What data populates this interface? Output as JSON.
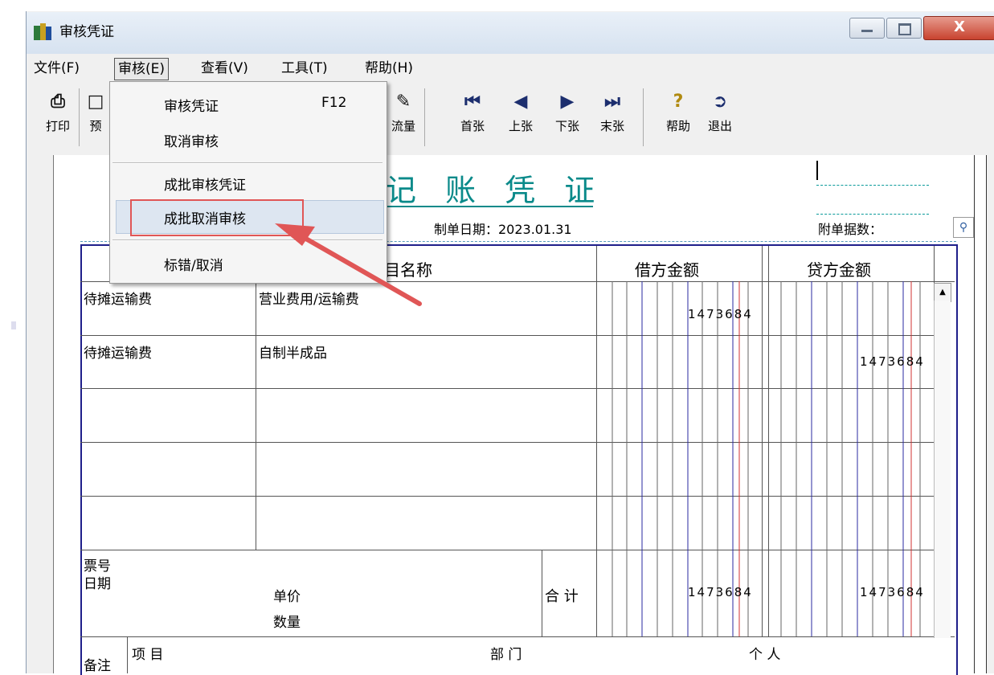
{
  "window": {
    "title": "审核凭证",
    "close_symbol": "X"
  },
  "menubar": [
    {
      "label": "文件(F)"
    },
    {
      "label": "审核(E)"
    },
    {
      "label": "查看(V)"
    },
    {
      "label": "工具(T)"
    },
    {
      "label": "帮助(H)"
    }
  ],
  "toolbar": {
    "print": "打印",
    "preview": "预",
    "flow": "流量",
    "first": "首张",
    "prev": "上张",
    "next": "下张",
    "last": "末张",
    "help": "帮助",
    "exit": "退出"
  },
  "dropdown": {
    "items": [
      {
        "label": "审核凭证",
        "shortcut": "F12"
      },
      {
        "label": "取消审核",
        "shortcut": ""
      },
      {
        "label": "成批审核凭证",
        "shortcut": ""
      },
      {
        "label": "成批取消审核",
        "shortcut": ""
      },
      {
        "label": "标错/取消",
        "shortcut": ""
      }
    ]
  },
  "voucher": {
    "title": "记 账 凭 证",
    "date_label": "制单日期：2023.01.31",
    "attachments_label": "附单据数：",
    "headers": {
      "account_name": "科目名称",
      "debit": "借方金额",
      "credit": "贷方金额"
    },
    "rows": [
      {
        "summary": "待摊运输费",
        "account": "营业费用/运输费",
        "debit": "1473684",
        "credit": ""
      },
      {
        "summary": "待摊运输费",
        "account": "自制半成品",
        "debit": "",
        "credit": "1473684"
      },
      {
        "summary": "",
        "account": "",
        "debit": "",
        "credit": ""
      },
      {
        "summary": "",
        "account": "",
        "debit": "",
        "credit": ""
      },
      {
        "summary": "",
        "account": "",
        "debit": "",
        "credit": ""
      }
    ],
    "footer": {
      "ticket_no": "票号",
      "date": "日期",
      "unit_price": "单价",
      "quantity": "数量",
      "total_label": "合 计",
      "total_debit": "1473684",
      "total_credit": "1473684"
    },
    "remarks": {
      "label": "备注",
      "project": "项 目",
      "department": "部 门",
      "person": "个 人"
    }
  },
  "colors": {
    "title_teal": "#0a8a8a",
    "grid_blue": "#1f1f8a",
    "callout_red": "#e05656"
  }
}
